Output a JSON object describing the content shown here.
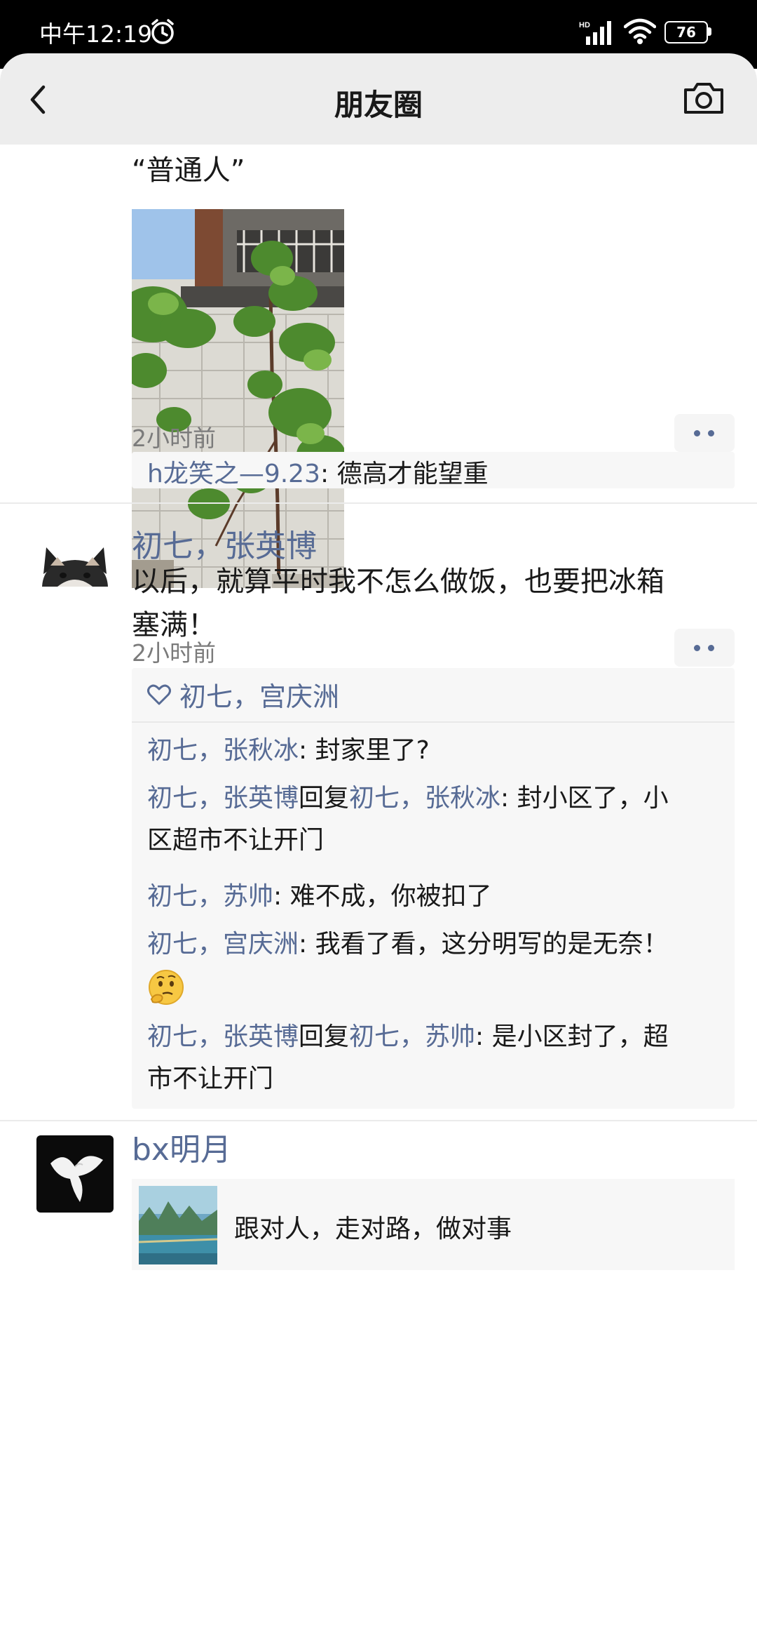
{
  "status_bar": {
    "time": "中午12:19",
    "signal_label": "HD",
    "battery": "76"
  },
  "nav": {
    "title": "朋友圈"
  },
  "post1": {
    "text": "“普通人”",
    "time": "2小时前",
    "comment": {
      "name": "h龙笑之—9.23",
      "sep": ": ",
      "text": "德高才能望重"
    }
  },
  "post2": {
    "author": "初七，张英博",
    "text_line1": "以后，就算平时我不怎么做饭，也要把冰箱",
    "text_line2": "塞满！",
    "time": "2小时前",
    "likes": "初七，宫庆洲",
    "comments": [
      {
        "name": "初七，张秋冰",
        "sep": ": ",
        "text": "封家里了?"
      },
      {
        "name": "初七，张英博",
        "reply_word": "回复",
        "reply_to": "初七，张秋冰",
        "sep": ": ",
        "text_line1": "封小区了，小",
        "text_line2": "区超市不让开门"
      },
      {
        "name": "初七，苏帅",
        "sep": ": ",
        "text": "难不成，你被扣了"
      },
      {
        "name": "初七，宫庆洲",
        "sep": ": ",
        "text": "我看了看，这分明写的是无奈！"
      },
      {
        "name": "初七，张英博",
        "reply_word": "回复",
        "reply_to": "初七，苏帅",
        "sep": ": ",
        "text_line1": "是小区封了，超",
        "text_line2": "市不让开门"
      }
    ]
  },
  "post3": {
    "author": "bx明月",
    "share_title": "跟对人，走对路，做对事"
  },
  "colors": {
    "link_blue": "#576b95",
    "nav_bg": "#ededed",
    "comment_bg": "#f7f7f7"
  },
  "icons": [
    "alarm-icon",
    "signal-icon",
    "wifi-icon",
    "battery-icon",
    "back-icon",
    "camera-icon",
    "heart-icon",
    "more-dots-icon",
    "thinking-emoji"
  ]
}
